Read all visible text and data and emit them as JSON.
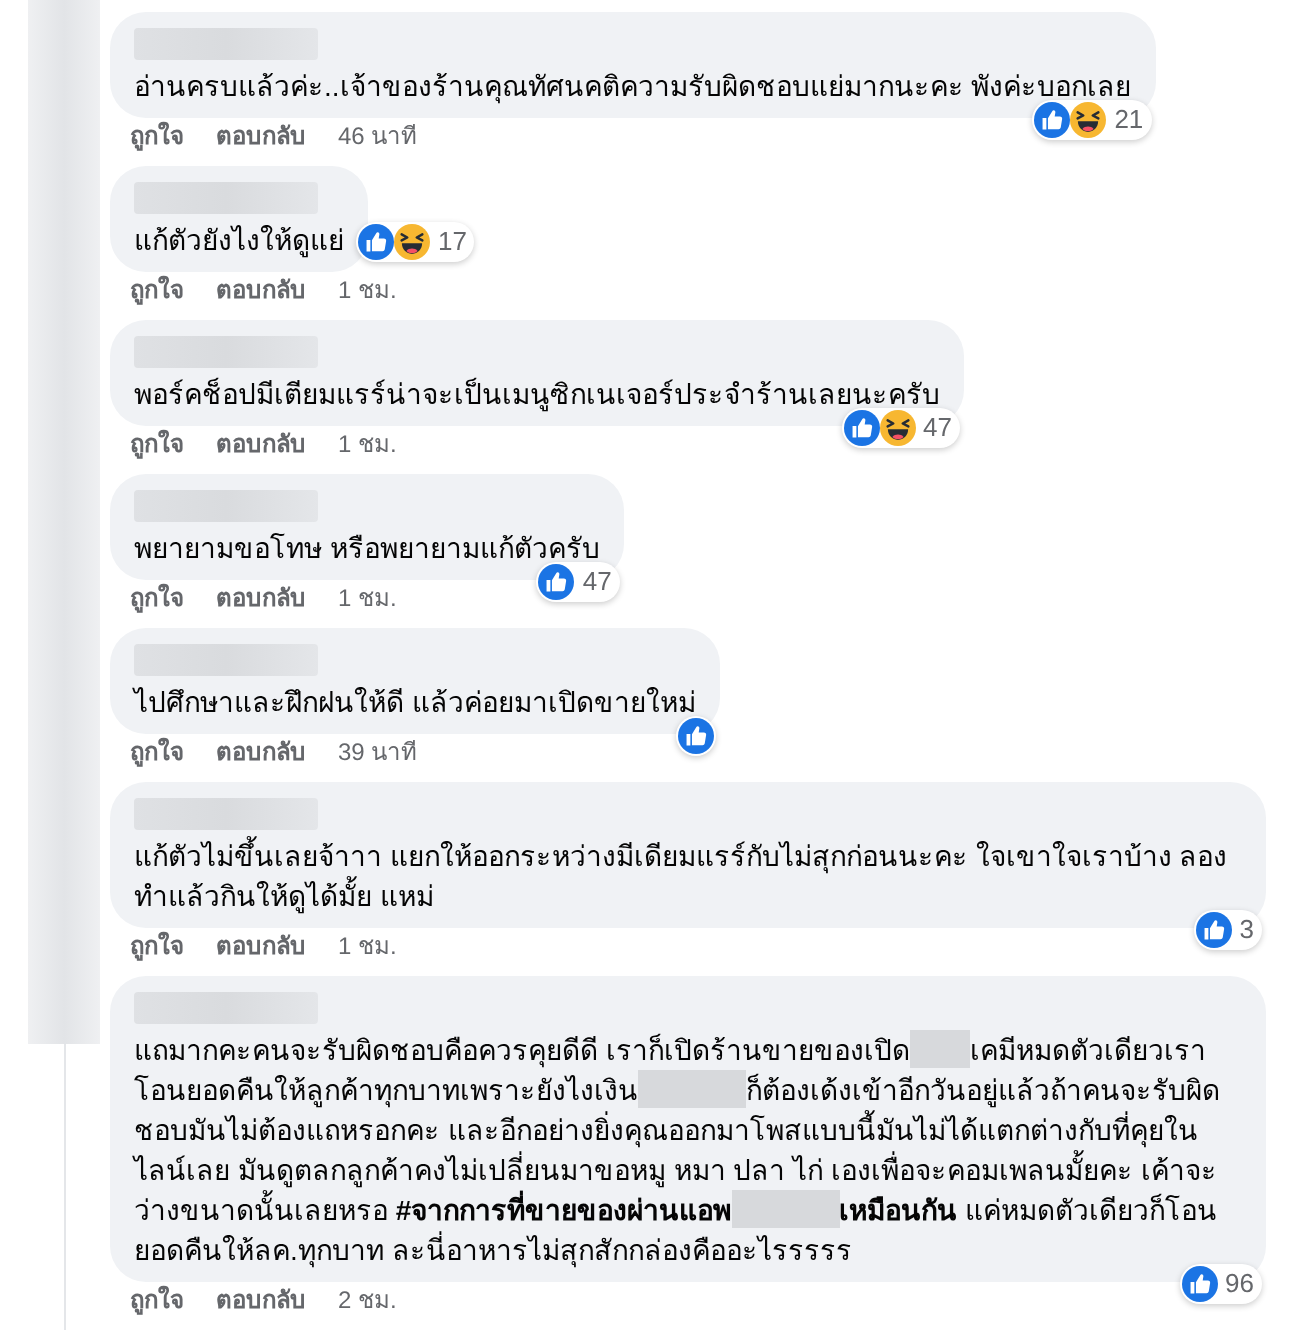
{
  "avatar_column": {
    "kind": "blurred"
  },
  "comments": [
    {
      "author_hidden": true,
      "segments": [
        {
          "kind": "text",
          "text": "อ่านครบแล้วค่ะ..เจ้าของร้านคุณทัศนคติความรับผิดชอบแย่มากนะคะ พังค่ะบอกเลย"
        }
      ],
      "reactions": {
        "kind": "corner",
        "icons": [
          {
            "kind": "like"
          },
          {
            "kind": "haha"
          }
        ],
        "count": "21"
      },
      "actions": [
        "ถูกใจ",
        "ตอบกลับ"
      ],
      "time": "46 นาที"
    },
    {
      "author_hidden": true,
      "segments": [
        {
          "kind": "text",
          "text": "แก้ตัวยังไงให้ดูแย่"
        }
      ],
      "reactions": {
        "kind": "beside",
        "icons": [
          {
            "kind": "like"
          },
          {
            "kind": "haha"
          }
        ],
        "count": "17"
      },
      "actions": [
        "ถูกใจ",
        "ตอบกลับ"
      ],
      "time": "1 ชม."
    },
    {
      "author_hidden": true,
      "segments": [
        {
          "kind": "text",
          "text": "พอร์คช็อปมีเตียมแรร์น่าจะเป็นเมนูซิกเนเจอร์ประจำร้านเลยนะครับ"
        }
      ],
      "reactions": {
        "kind": "corner",
        "icons": [
          {
            "kind": "like"
          },
          {
            "kind": "haha"
          }
        ],
        "count": "47"
      },
      "actions": [
        "ถูกใจ",
        "ตอบกลับ"
      ],
      "time": "1 ชม."
    },
    {
      "author_hidden": true,
      "segments": [
        {
          "kind": "text",
          "text": "พยายามขอโทษ หรือพยายามแก้ตัวครับ"
        }
      ],
      "reactions": {
        "kind": "corner",
        "icons": [
          {
            "kind": "like"
          }
        ],
        "count": "47"
      },
      "actions": [
        "ถูกใจ",
        "ตอบกลับ"
      ],
      "time": "1 ชม."
    },
    {
      "author_hidden": true,
      "segments": [
        {
          "kind": "text",
          "text": "ไปศึกษาและฝึกฝนให้ดี แล้วค่อยมาเปิดขายใหม่"
        }
      ],
      "reactions": {
        "kind": "corner",
        "icons": [
          {
            "kind": "like"
          }
        ]
      },
      "actions": [
        "ถูกใจ",
        "ตอบกลับ"
      ],
      "time": "39 นาที"
    },
    {
      "author_hidden": true,
      "segments": [
        {
          "kind": "text",
          "text": "แก้ตัวไม่ขึ้นเลยจ้าาา แยกให้ออกระหว่างมีเดียมแรร์กับไม่สุกก่อนนะคะ ใจเขาใจเราบ้าง ลอง ทำแล้วกินให้ดูได้มั้ย แหม่"
        }
      ],
      "reactions": {
        "kind": "corner",
        "icons": [
          {
            "kind": "like"
          }
        ],
        "count": "3"
      },
      "actions": [
        "ถูกใจ",
        "ตอบกลับ"
      ],
      "time": "1 ชม."
    },
    {
      "author_hidden": true,
      "segments": [
        {
          "kind": "text",
          "text": "แถมากคะคนจะรับผิดชอบคือควรคุยดีดี เราก็เปิดร้านขายของเปิด"
        },
        {
          "kind": "redaction"
        },
        {
          "kind": "text",
          "text": "เคมีหมดตัวเดียวเราโอนยอดคืนให้ลูกค้าทุกบาทเพราะยังไงเงิน"
        },
        {
          "kind": "wideredaction"
        },
        {
          "kind": "text",
          "text": "ก็ต้องเด้งเข้าอีกวันอยู่แล้วถ้าคนจะรับผิดชอบมันไม่ต้องแถหรอกคะ และอีกอย่างยิ่งคุณออกมาโพสแบบนี้มันไม่ได้แตกต่างกับที่คุยในไลน์เลย มันดูตลกลูกค้าคงไม่เปลี่ยนมาขอหมู หมา ปลา ไก่ เองเพื่อจะคอมเพลนมั้ยคะ เค้าจะว่างขนาดนั้นเลยหรอ **#จากการที่ขายของผ่านแอพ**"
        },
        {
          "kind": "wideredaction"
        },
        {
          "kind": "text",
          "text": "**เหมือนกัน** แค่หมดตัวเดียวก็โอนยอดคืนให้ลค.ทุกบาท ละนี่อาหารไม่สุกสักกล่องคืออะไรรรรร"
        }
      ],
      "reactions": {
        "kind": "corner",
        "icons": [
          {
            "kind": "like"
          }
        ],
        "count": "96"
      },
      "actions": [
        "ถูกใจ",
        "ตอบกลับ"
      ],
      "time": "2 ชม."
    }
  ]
}
